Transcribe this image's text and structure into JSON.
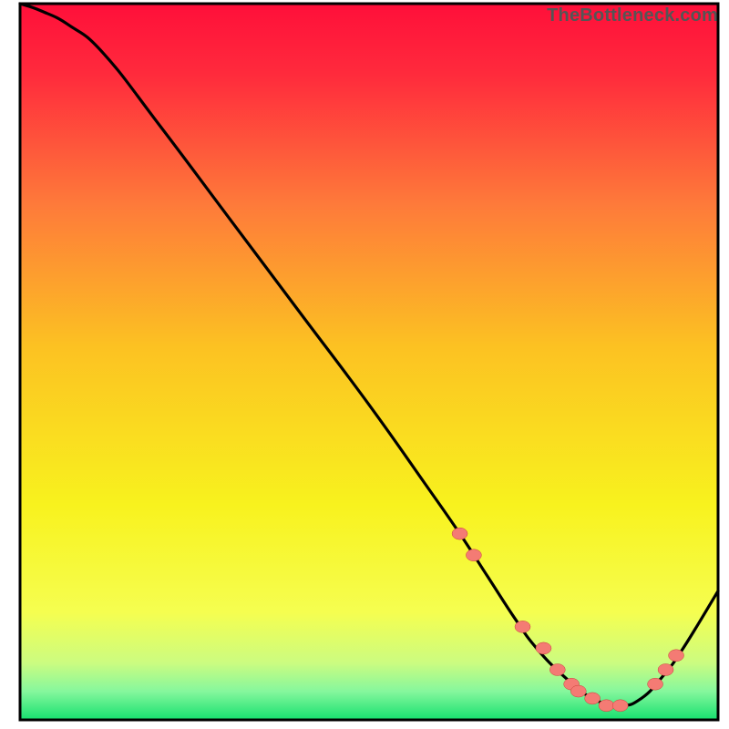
{
  "watermark": "TheBottleneck.com",
  "chart_data": {
    "type": "line",
    "xlim": [
      0,
      100
    ],
    "ylim": [
      0,
      100
    ],
    "title": "",
    "xlabel": "",
    "ylabel": "",
    "series": [
      {
        "name": "curve",
        "x": [
          0,
          3,
          7,
          12,
          20,
          30,
          40,
          50,
          58,
          63,
          67,
          71,
          74,
          78,
          82,
          86,
          89,
          92,
          95,
          100
        ],
        "y": [
          100,
          99,
          97,
          93,
          83,
          70,
          57,
          44,
          33,
          26,
          20,
          14,
          10,
          6,
          3,
          2,
          3,
          6,
          10,
          18
        ]
      }
    ],
    "markers": {
      "name": "highlight-dots",
      "x": [
        63,
        65,
        72,
        75,
        77,
        79,
        80,
        82,
        84,
        86,
        91,
        92.5,
        94
      ],
      "y": [
        26,
        23,
        13,
        10,
        7,
        5,
        4,
        3,
        2,
        2,
        5,
        7,
        9
      ]
    },
    "gradient_stops": [
      {
        "offset": 0.0,
        "color": "#FF0F3A"
      },
      {
        "offset": 0.1,
        "color": "#FF2B3C"
      },
      {
        "offset": 0.28,
        "color": "#FE7A3A"
      },
      {
        "offset": 0.48,
        "color": "#FCC222"
      },
      {
        "offset": 0.7,
        "color": "#F8F21E"
      },
      {
        "offset": 0.85,
        "color": "#F5FE50"
      },
      {
        "offset": 0.92,
        "color": "#CCFC80"
      },
      {
        "offset": 0.96,
        "color": "#86F79D"
      },
      {
        "offset": 1.0,
        "color": "#16E06F"
      }
    ],
    "colors": {
      "curve_stroke": "#000000",
      "marker_fill": "#F47B74",
      "marker_stroke": "#C94039",
      "border": "#000000"
    }
  }
}
